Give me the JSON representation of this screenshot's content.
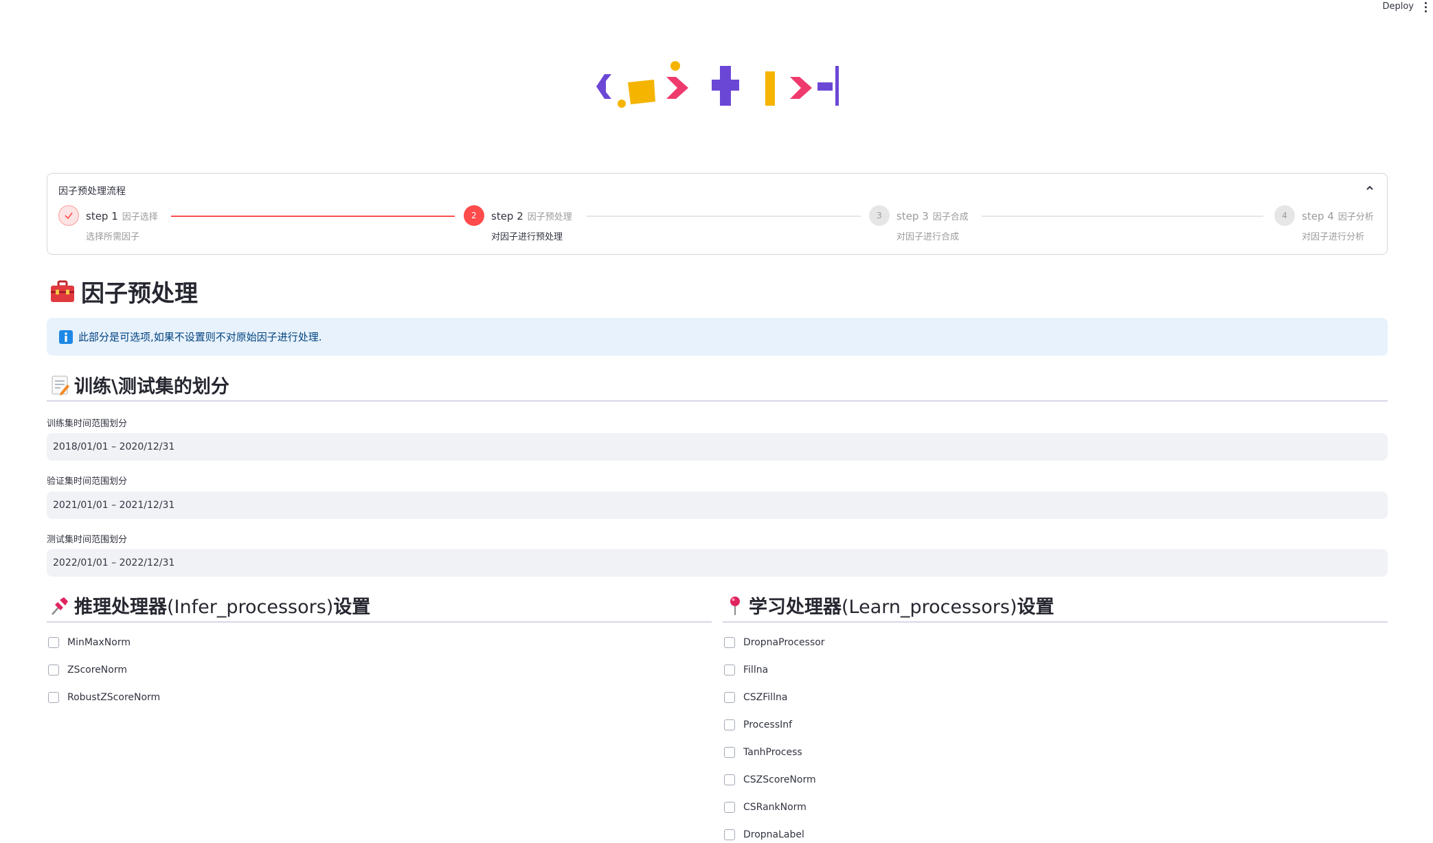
{
  "topbar": {
    "deploy_label": "Deploy"
  },
  "stepper": {
    "title": "因子预处理流程",
    "steps": [
      {
        "num": "",
        "title": "step 1",
        "sub": "因子选择",
        "desc": "选择所需因子",
        "state": "done"
      },
      {
        "num": "2",
        "title": "step 2",
        "sub": "因子预处理",
        "desc": "对因子进行预处理",
        "state": "active"
      },
      {
        "num": "3",
        "title": "step 3",
        "sub": "因子合成",
        "desc": "对因子进行合成",
        "state": "pending"
      },
      {
        "num": "4",
        "title": "step 4",
        "sub": "因子分析",
        "desc": "对因子进行分析",
        "state": "pending"
      }
    ]
  },
  "page": {
    "title": "因子预处理"
  },
  "info": {
    "text": "此部分是可选项,如果不设置则不对原始因子进行处理."
  },
  "split_section": {
    "heading": "训练\\测试集的划分",
    "fields": [
      {
        "label": "训练集时间范围划分",
        "value": "2018/01/01 – 2020/12/31"
      },
      {
        "label": "验证集时间范围划分",
        "value": "2021/01/01 – 2021/12/31"
      },
      {
        "label": "测试集时间范围划分",
        "value": "2022/01/01 – 2022/12/31"
      }
    ]
  },
  "infer_section": {
    "heading_a": "推理处理器",
    "heading_b": "(Infer_processors)",
    "heading_c": "设置",
    "options": [
      "MinMaxNorm",
      "ZScoreNorm",
      "RobustZScoreNorm"
    ]
  },
  "learn_section": {
    "heading_a": "学习处理器",
    "heading_b": "(Learn_processors)",
    "heading_c": "设置",
    "options": [
      "DropnaProcessor",
      "Fillna",
      "CSZFillna",
      "ProcessInf",
      "TanhProcess",
      "CSZScoreNorm",
      "CSRankNorm",
      "DropnaLabel"
    ]
  },
  "colors": {
    "primary": "#ff4b4b",
    "done_bg": "#fde3e3",
    "pending_bg": "#e6e6e6",
    "info_bg": "#e8f2fc",
    "input_bg": "#f0f2f6"
  }
}
